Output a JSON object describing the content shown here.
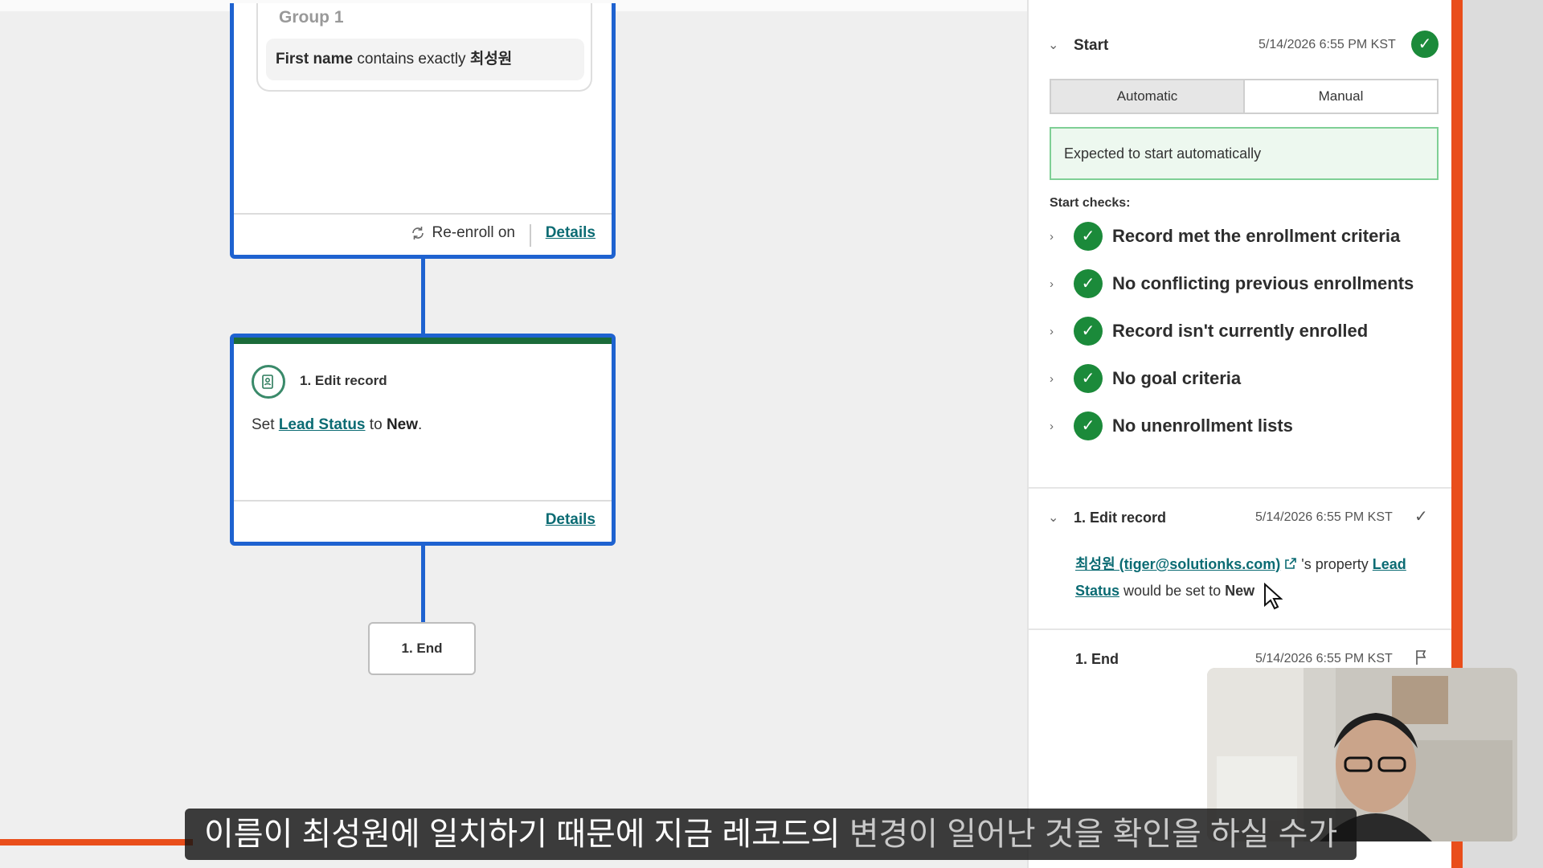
{
  "canvas": {
    "enroll_card": {
      "group_title": "Group 1",
      "condition_field": "First name",
      "condition_op": "contains exactly",
      "condition_value": "최성원",
      "reenroll_label": "Re-enroll on",
      "details_label": "Details"
    },
    "edit_card": {
      "title": "1. Edit record",
      "desc_prefix": "Set",
      "property": "Lead Status",
      "desc_mid": "to",
      "value": "New",
      "period": ".",
      "details_label": "Details"
    },
    "end_node": {
      "label": "1. End"
    }
  },
  "panel": {
    "start": {
      "title": "Start",
      "timestamp": "5/14/2026 6:55 PM KST",
      "tabs": [
        "Automatic",
        "Manual"
      ],
      "notice": "Expected to start automatically",
      "checks_label": "Start checks:",
      "checks": [
        "Record met the enrollment criteria",
        "No conflicting previous enrollments",
        "Record isn't currently enrolled",
        "No goal criteria",
        "No unenrollment lists"
      ]
    },
    "edit_record": {
      "title": "1. Edit record",
      "timestamp": "5/14/2026 6:55 PM KST",
      "contact": "최성원 (tiger@solutionks.com)",
      "text_property": "'s property",
      "property": "Lead Status",
      "text_set": "would be set to",
      "value": "New"
    },
    "end": {
      "title": "1. End",
      "timestamp": "5/14/2026 6:55 PM KST"
    }
  },
  "subtitle": {
    "main": "이름이 최성원에 일치하기 때문에 지금 레코드의",
    "dim": "변경이 일어난 것을 확인을 하실 수가"
  },
  "colors": {
    "accent_blue": "#1e62d0",
    "success_green": "#1b8a3a",
    "link_teal": "#0b6b73",
    "frame_orange": "#e94e1b"
  }
}
